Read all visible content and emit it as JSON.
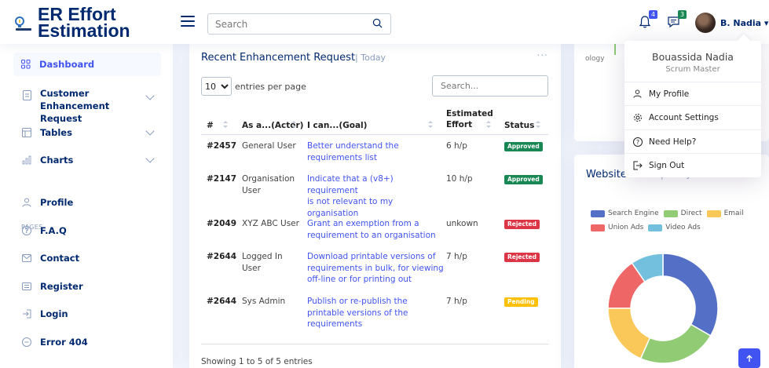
{
  "app": {
    "title_line1": "ER Effort",
    "title_line2": "Estimation"
  },
  "header": {
    "search_placeholder": "Search",
    "notifications_count": "4",
    "messages_count": "3",
    "user_name": "B. Nadia ▾"
  },
  "sidebar": {
    "items": [
      {
        "label": "Dashboard",
        "icon": "grid-icon"
      },
      {
        "label_line1": "Customer Enhancement",
        "label_line2": "Request",
        "icon": "document-icon"
      },
      {
        "label": "Tables",
        "icon": "layout-icon"
      },
      {
        "label": "Charts",
        "icon": "bar-chart-icon"
      },
      {
        "label": "Profile",
        "icon": "person-icon"
      },
      {
        "label": "F.A.Q",
        "icon": "question-circle-icon"
      },
      {
        "label": "Contact",
        "icon": "envelope-icon"
      },
      {
        "label": "Register",
        "icon": "card-list-icon"
      },
      {
        "label": "Login",
        "icon": "box-arrow-in-right-icon"
      },
      {
        "label": "Error 404",
        "icon": "dash-circle-icon"
      }
    ],
    "pages_heading": "PAGES"
  },
  "recent": {
    "title": "Recent Enhancement Request",
    "subtitle": "| Today",
    "more": "...",
    "per_page_value": "10",
    "per_page_label": "entries per page",
    "search_placeholder": "Search...",
    "columns": {
      "id": "#",
      "actor": "As a...(Actor)",
      "goal": "I can...(Goal)",
      "effort_line1": "Estimated",
      "effort_line2": "Effort",
      "status": "Status"
    },
    "rows": [
      {
        "id": "#2457",
        "actor_l1": "General User",
        "actor_l2": "",
        "goal_l1": "Better understand the",
        "goal_l2": "requirements list",
        "goal_l3": "",
        "effort": "6 h/p",
        "status": "Approved"
      },
      {
        "id": "#2147",
        "actor_l1": "Organisation",
        "actor_l2": "User",
        "goal_l1": "Indicate that a (v8+) requirement",
        "goal_l2": "is not relevant to my",
        "goal_l3": "organisation",
        "effort": "10 h/p",
        "status": "Approved"
      },
      {
        "id": "#2049",
        "actor_l1": "XYZ ABC User",
        "actor_l2": "",
        "goal_l1": "Grant an exemption from a",
        "goal_l2": "requirement to an organisation",
        "goal_l3": "",
        "effort": "unkown",
        "status": "Rejected"
      },
      {
        "id": "#2644",
        "actor_l1": "Logged In",
        "actor_l2": "User",
        "goal_l1": "Download printable versions of",
        "goal_l2": "requirements in bulk, for viewing",
        "goal_l3": "off-line or for printing out",
        "effort": "7 h/p",
        "status": "Rejected"
      },
      {
        "id": "#2644",
        "actor_l1": "Sys Admin",
        "actor_l2": "",
        "goal_l1": "Publish or re-publish the",
        "goal_l2": "printable versions of the",
        "goal_l3": "requirements",
        "effort": "7 h/p",
        "status": "Pending"
      }
    ],
    "footer": "Showing 1 to 5 of 5 entries"
  },
  "status_colors": {
    "Approved": "#198754",
    "Rejected": "#dc3545",
    "Pending": "#ffc107"
  },
  "right_card": {
    "partial_text": "ology"
  },
  "traffic": {
    "title": "Website Traffic",
    "subtitle": "| Today",
    "legend": [
      {
        "name": "Search Engine",
        "color": "#5470c6"
      },
      {
        "name": "Direct",
        "color": "#91cc75"
      },
      {
        "name": "Email",
        "color": "#fac858"
      },
      {
        "name": "Union Ads",
        "color": "#ee6666"
      },
      {
        "name": "Video Ads",
        "color": "#73c0de"
      }
    ]
  },
  "chart_data": {
    "type": "pie",
    "title": "Website Traffic",
    "categories": [
      "Search Engine",
      "Direct",
      "Email",
      "Union Ads",
      "Video Ads"
    ],
    "values": [
      1048,
      735,
      580,
      484,
      300
    ],
    "colors": [
      "#5470c6",
      "#91cc75",
      "#fac858",
      "#ee6666",
      "#73c0de"
    ],
    "donut": true
  },
  "profile_menu": {
    "name": "Bouassida Nadia",
    "role": "Scrum Master",
    "items": [
      {
        "label": "My Profile",
        "icon": "person-icon"
      },
      {
        "label": "Account Settings",
        "icon": "gear-icon"
      },
      {
        "label": "Need Help?",
        "icon": "question-circle-icon"
      },
      {
        "label": "Sign Out",
        "icon": "box-arrow-right-icon"
      }
    ]
  }
}
